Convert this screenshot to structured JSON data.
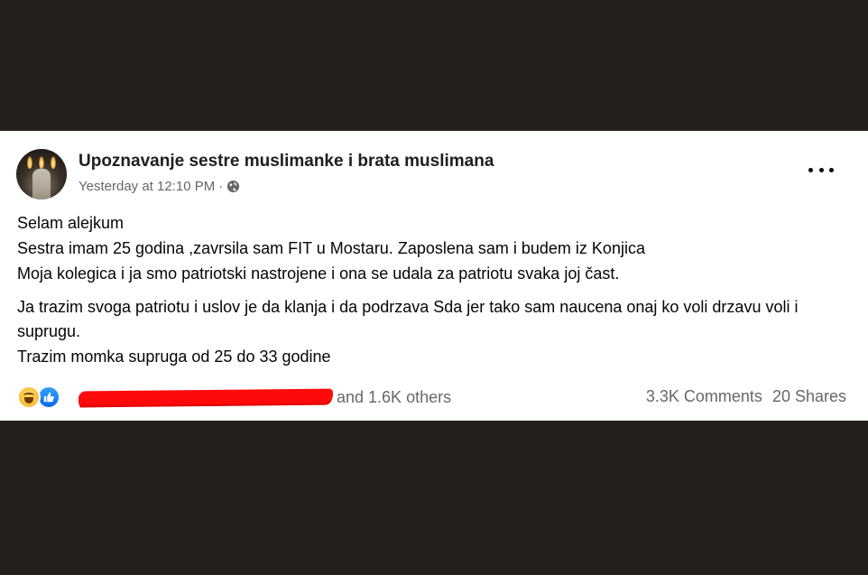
{
  "post": {
    "group_name": "Upoznavanje sestre muslimanke i brata muslimana",
    "timestamp": "Yesterday at 12:10 PM",
    "separator": "·",
    "privacy_icon": "globe-icon",
    "more_icon": "more-options-icon",
    "body": {
      "line1": "Selam alejkum",
      "line2": "Sestra imam 25 godina ,zavrsila sam FIT u Mostaru. Zaposlena sam i budem iz Konjica",
      "line3": "Moja kolegica i ja smo patriotski nastrojene i ona se udala za patriotu svaka joj čast.",
      "line4": "Ja trazim svoga patriotu i uslov je da klanja i da podrzava Sda jer tako sam naucena onaj ko voli drzavu voli i suprugu.",
      "line5": "Trazim momka supruga od 25 do 33 godine"
    },
    "reactions": {
      "icons": [
        "haha-icon",
        "like-icon"
      ],
      "others_text": "and 1.6K others",
      "redaction_color": "#ff0a0a"
    },
    "stats": {
      "comments": "3.3K Comments",
      "shares": "20 Shares"
    }
  },
  "colors": {
    "background": "#231f1c",
    "card": "#ffffff",
    "primary_text": "#050505",
    "secondary_text": "#65676b",
    "like_blue": "#0a67e8"
  }
}
